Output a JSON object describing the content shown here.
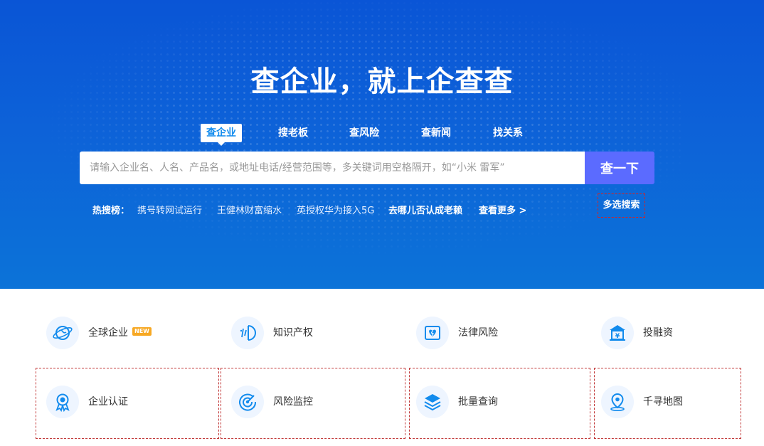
{
  "hero": {
    "title": "查企业，就上企查查",
    "tabs": [
      {
        "label": "查企业",
        "active": true
      },
      {
        "label": "搜老板",
        "active": false
      },
      {
        "label": "查风险",
        "active": false
      },
      {
        "label": "查新闻",
        "active": false
      },
      {
        "label": "找关系",
        "active": false
      }
    ],
    "search": {
      "placeholder": "请输入企业名、人名、产品名，或地址电话/经营范围等，多关键词用空格隔开，如“小米 雷军”",
      "value": "",
      "button_label": "查一下"
    },
    "hot": {
      "label": "热搜榜：",
      "items": [
        "携号转网试运行",
        "王健林财富缩水",
        "英授权华为接入5G",
        "去哪儿否认成老赖"
      ],
      "more_label": "查看更多 >"
    },
    "multi_search_label": "多选搜索"
  },
  "features": [
    {
      "label": "全球企业",
      "icon": "globe-icon",
      "badge": "NEW"
    },
    {
      "label": "知识产权",
      "icon": "ip-icon"
    },
    {
      "label": "法律风险",
      "icon": "shield-broken-icon"
    },
    {
      "label": "投融资",
      "icon": "bank-yen-icon"
    },
    {
      "label": "企业认证",
      "icon": "certificate-icon"
    },
    {
      "label": "风险监控",
      "icon": "radar-icon"
    },
    {
      "label": "批量查询",
      "icon": "layers-icon"
    },
    {
      "label": "千寻地图",
      "icon": "map-pin-icon"
    }
  ],
  "colors": {
    "hero_blue": "#0d62d8",
    "search_button": "#5b6bff",
    "active_tab_text": "#128bed",
    "icon_blue": "#128bed",
    "badge_orange": "#f7a823"
  }
}
